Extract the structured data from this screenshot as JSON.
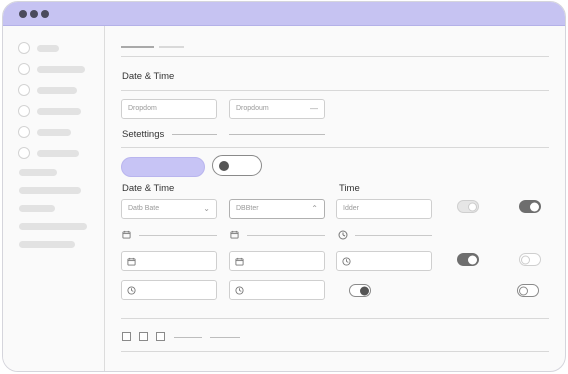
{
  "sections": {
    "date_time_heading": "Date & Time",
    "settings_heading": "Setettings",
    "date_time_label": "Date & Time",
    "time_label": "Time"
  },
  "dropdowns": {
    "first": "Dropdom",
    "second": "Dropdoum"
  },
  "fields": {
    "date_picker_1": "Datb Bate",
    "date_picker_2": "DBBter",
    "time_input": "Idder"
  },
  "icons": {
    "calendar": "calendar-icon",
    "clock": "clock-icon",
    "chevron": "chevron-down-icon"
  },
  "colors": {
    "accent": "#c7c4f5",
    "titlebar": "#c6c3f2",
    "toggle_on": "#6e6e6e"
  }
}
